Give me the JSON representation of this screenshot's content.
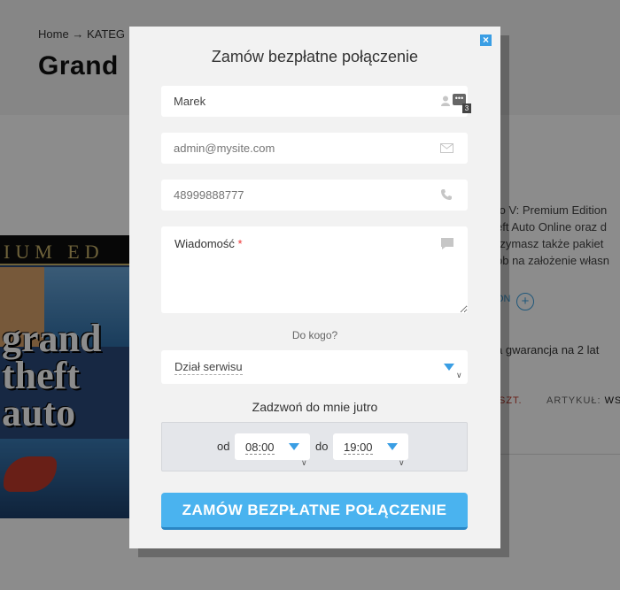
{
  "background_page": {
    "breadcrumb_home": "Home",
    "breadcrumb_sep": "→",
    "breadcrumb_category": "KATEG",
    "title": "Grand",
    "image_band_text": "IUM ED",
    "image_logo_lines": [
      "grand",
      "theft",
      "auto"
    ],
    "description_lines": [
      "to V: Premium Edition",
      "eft Auto Online oraz d",
      "rzymasz także pakiet",
      "ób na założenie własn"
    ],
    "more_label": "ON",
    "warranty": "a gwarancja na 2 lat",
    "unit_label": "SZT.",
    "article_label": "ARTYKUŁ:",
    "article_value": "WS"
  },
  "modal": {
    "title": "Zamów bezpłatne połączenie",
    "close_icon": "close-icon",
    "name_value": "Marek",
    "badge_count": "3",
    "email_placeholder": "admin@mysite.com",
    "phone_placeholder": "48999888777",
    "message_label": "Wiadomość",
    "message_required": "*",
    "to_whom_label": "Do kogo?",
    "department_value": "Dział serwisu",
    "callback_label": "Zadzwoń do mnie jutro",
    "from_label": "od",
    "from_value": "08:00",
    "to_label": "do",
    "to_value": "19:00",
    "submit_label": "ZAMÓW BEZPŁATNE POŁĄCZENIE"
  },
  "colors": {
    "accent": "#4ab3ef",
    "close_bg": "#3a9ee4",
    "modal_bg": "#f2f2f2"
  }
}
